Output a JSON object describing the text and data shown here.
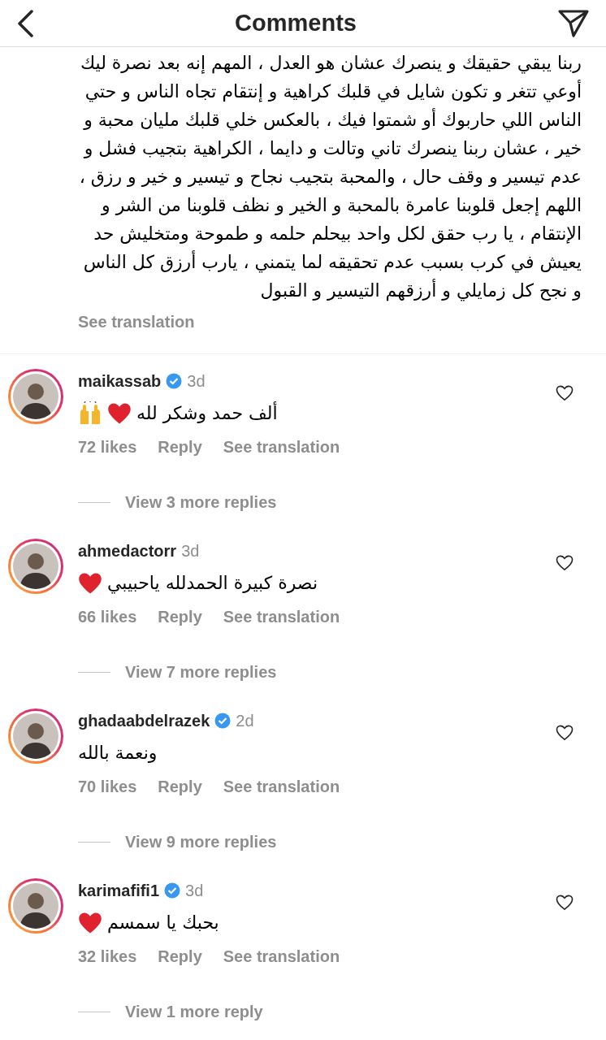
{
  "header": {
    "title": "Comments"
  },
  "caption": {
    "text": "ربنا يبقي حقيقك و ينصرك عشان هو العدل ، المهم إنه بعد نصرة ليك أوعي تتغر و تكون شايل في قلبك كراهية و إنتقام تجاه الناس و حتي الناس اللي حاربوك أو شمتوا فيك ، بالعكس خلي قلبك مليان محبة و خير ، عشان ربنا ينصرك تاني وتالت و دايما ، الكراهية بتجيب فشل و عدم تيسير و وقف حال ، والمحبة بتجيب نجاح و تيسير و خير و رزق ، اللهم إجعل قلوبنا عامرة بالمحبة و الخير و نظف قلوبنا من الشر و الإنتقام ، يا رب حقق لكل واحد بيحلم حلمه و طموحة ومتخليش حد يعيش في كرب بسبب عدم تحقيقه لما يتمني ، يارب أرزق كل الناس و نجح كل زمايلي و أرزقهم التيسير و القبول",
    "see_translation": "See translation"
  },
  "comments": [
    {
      "username": "maikassab",
      "verified": true,
      "time": "3d",
      "text": "ألف حمد وشكر لله",
      "emojis": [
        {
          "kind": "raised-hands"
        },
        {
          "kind": "heart"
        }
      ],
      "likes": "72 likes",
      "reply": "Reply",
      "see_translation": "See translation",
      "view_replies": "View 3 more replies",
      "liked": false
    },
    {
      "username": "ahmedactorr",
      "verified": false,
      "time": "3d",
      "text": "نصرة كبيرة الحمدلله ياحبيبي",
      "emojis": [
        {
          "kind": "heart"
        }
      ],
      "likes": "66 likes",
      "reply": "Reply",
      "see_translation": "See translation",
      "view_replies": "View 7 more replies",
      "liked": false
    },
    {
      "username": "ghadaabdelrazek",
      "verified": true,
      "time": "2d",
      "text": "ونعمة بالله",
      "likes": "70 likes",
      "reply": "Reply",
      "see_translation": "See translation",
      "view_replies": "View 9 more replies",
      "liked": false
    },
    {
      "username": "karimafifi1",
      "verified": true,
      "time": "3d",
      "text": "بحبك يا سمسم",
      "emojis": [
        {
          "kind": "heart"
        }
      ],
      "likes": "32 likes",
      "reply": "Reply",
      "see_translation": "See translation",
      "view_replies": "View 1 more reply",
      "liked": false
    }
  ]
}
